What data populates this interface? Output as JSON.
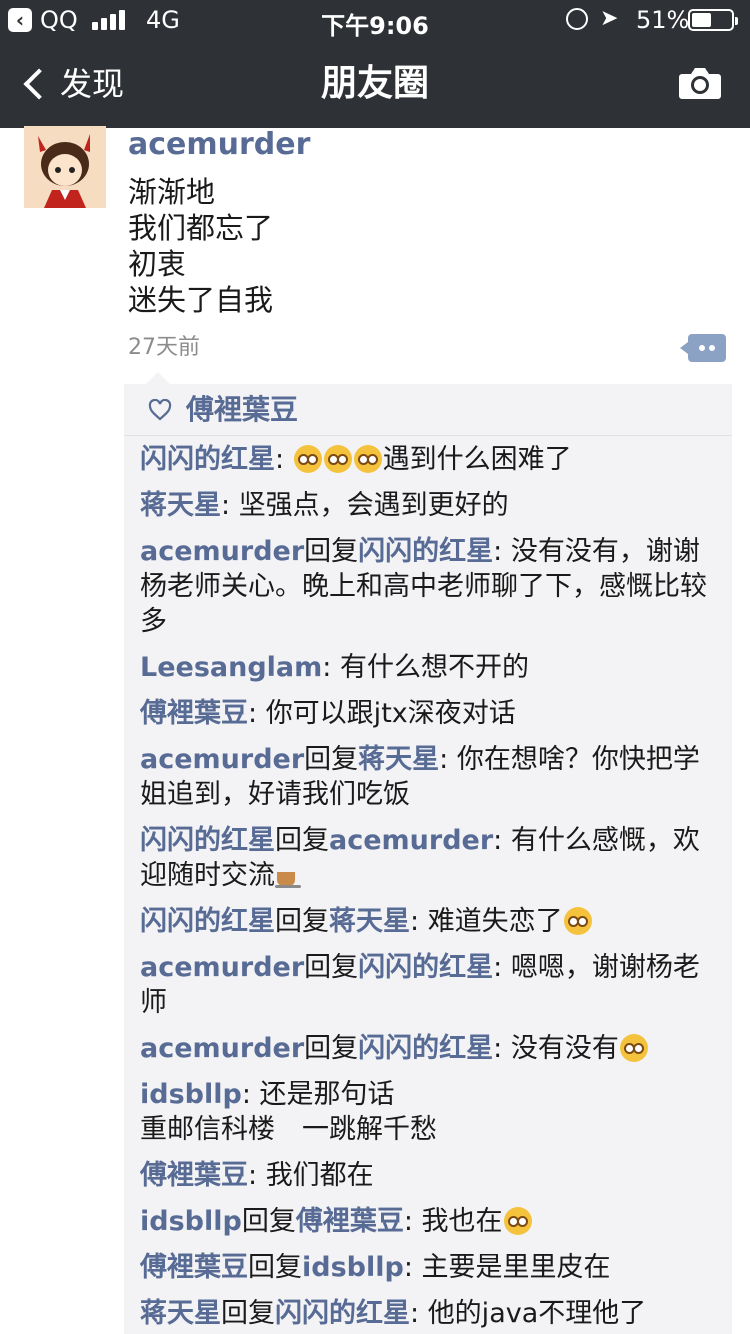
{
  "status_bar": {
    "back_app": "QQ",
    "network": "4G",
    "time": "下午9:06",
    "battery_pct": "51%",
    "battery_level": 0.51
  },
  "nav": {
    "back_label": "发现",
    "title": "朋友圈"
  },
  "post": {
    "username": "acemurder",
    "lines": [
      "渐渐地",
      "我们都忘了",
      "初衷",
      "迷失了自我"
    ],
    "time": "27天前"
  },
  "likes": {
    "names": "傅裡葉豆"
  },
  "comments": [
    {
      "from": "闪闪的红星",
      "to": "",
      "text": "遇到什么困难了",
      "prefix_emoji_count": 3
    },
    {
      "from": "蒋天星",
      "to": "",
      "text": "坚强点，会遇到更好的"
    },
    {
      "from": "acemurder",
      "to": "闪闪的红星",
      "text": "没有没有，谢谢杨老师关心。晚上和高中老师聊了下，感慨比较多"
    },
    {
      "from": "Leesanglam",
      "to": "",
      "text": "有什么想不开的"
    },
    {
      "from": "傅裡葉豆",
      "to": "",
      "text": "你可以跟jtx深夜对话"
    },
    {
      "from": "acemurder",
      "to": "蒋天星",
      "text": "你在想啥？你快把学姐追到，好请我们吃饭"
    },
    {
      "from": "闪闪的红星",
      "to": "acemurder",
      "text": "有什么感慨，欢迎随时交流",
      "suffix": "cup"
    },
    {
      "from": "闪闪的红星",
      "to": "蒋天星",
      "text": "难道失恋了",
      "suffix": "emoji"
    },
    {
      "from": "acemurder",
      "to": "闪闪的红星",
      "text": "嗯嗯，谢谢杨老师"
    },
    {
      "from": "acemurder",
      "to": "闪闪的红星",
      "text": "没有没有",
      "suffix": "emoji"
    },
    {
      "from": "idsbllp",
      "to": "",
      "text": "还是那句话\n重邮信科楼　一跳解千愁"
    },
    {
      "from": "傅裡葉豆",
      "to": "",
      "text": "我们都在"
    },
    {
      "from": "idsbllp",
      "to": "傅裡葉豆",
      "text": "我也在",
      "suffix": "emoji"
    },
    {
      "from": "傅裡葉豆",
      "to": "idsbllp",
      "text": "主要是里里皮在"
    },
    {
      "from": "蒋天星",
      "to": "闪闪的红星",
      "text": "他的java不理他了"
    }
  ],
  "reply_word": "回复",
  "colors": {
    "nav_bg": "#2e3135",
    "link": "#576b95",
    "comment_bg": "#f3f3f5"
  }
}
